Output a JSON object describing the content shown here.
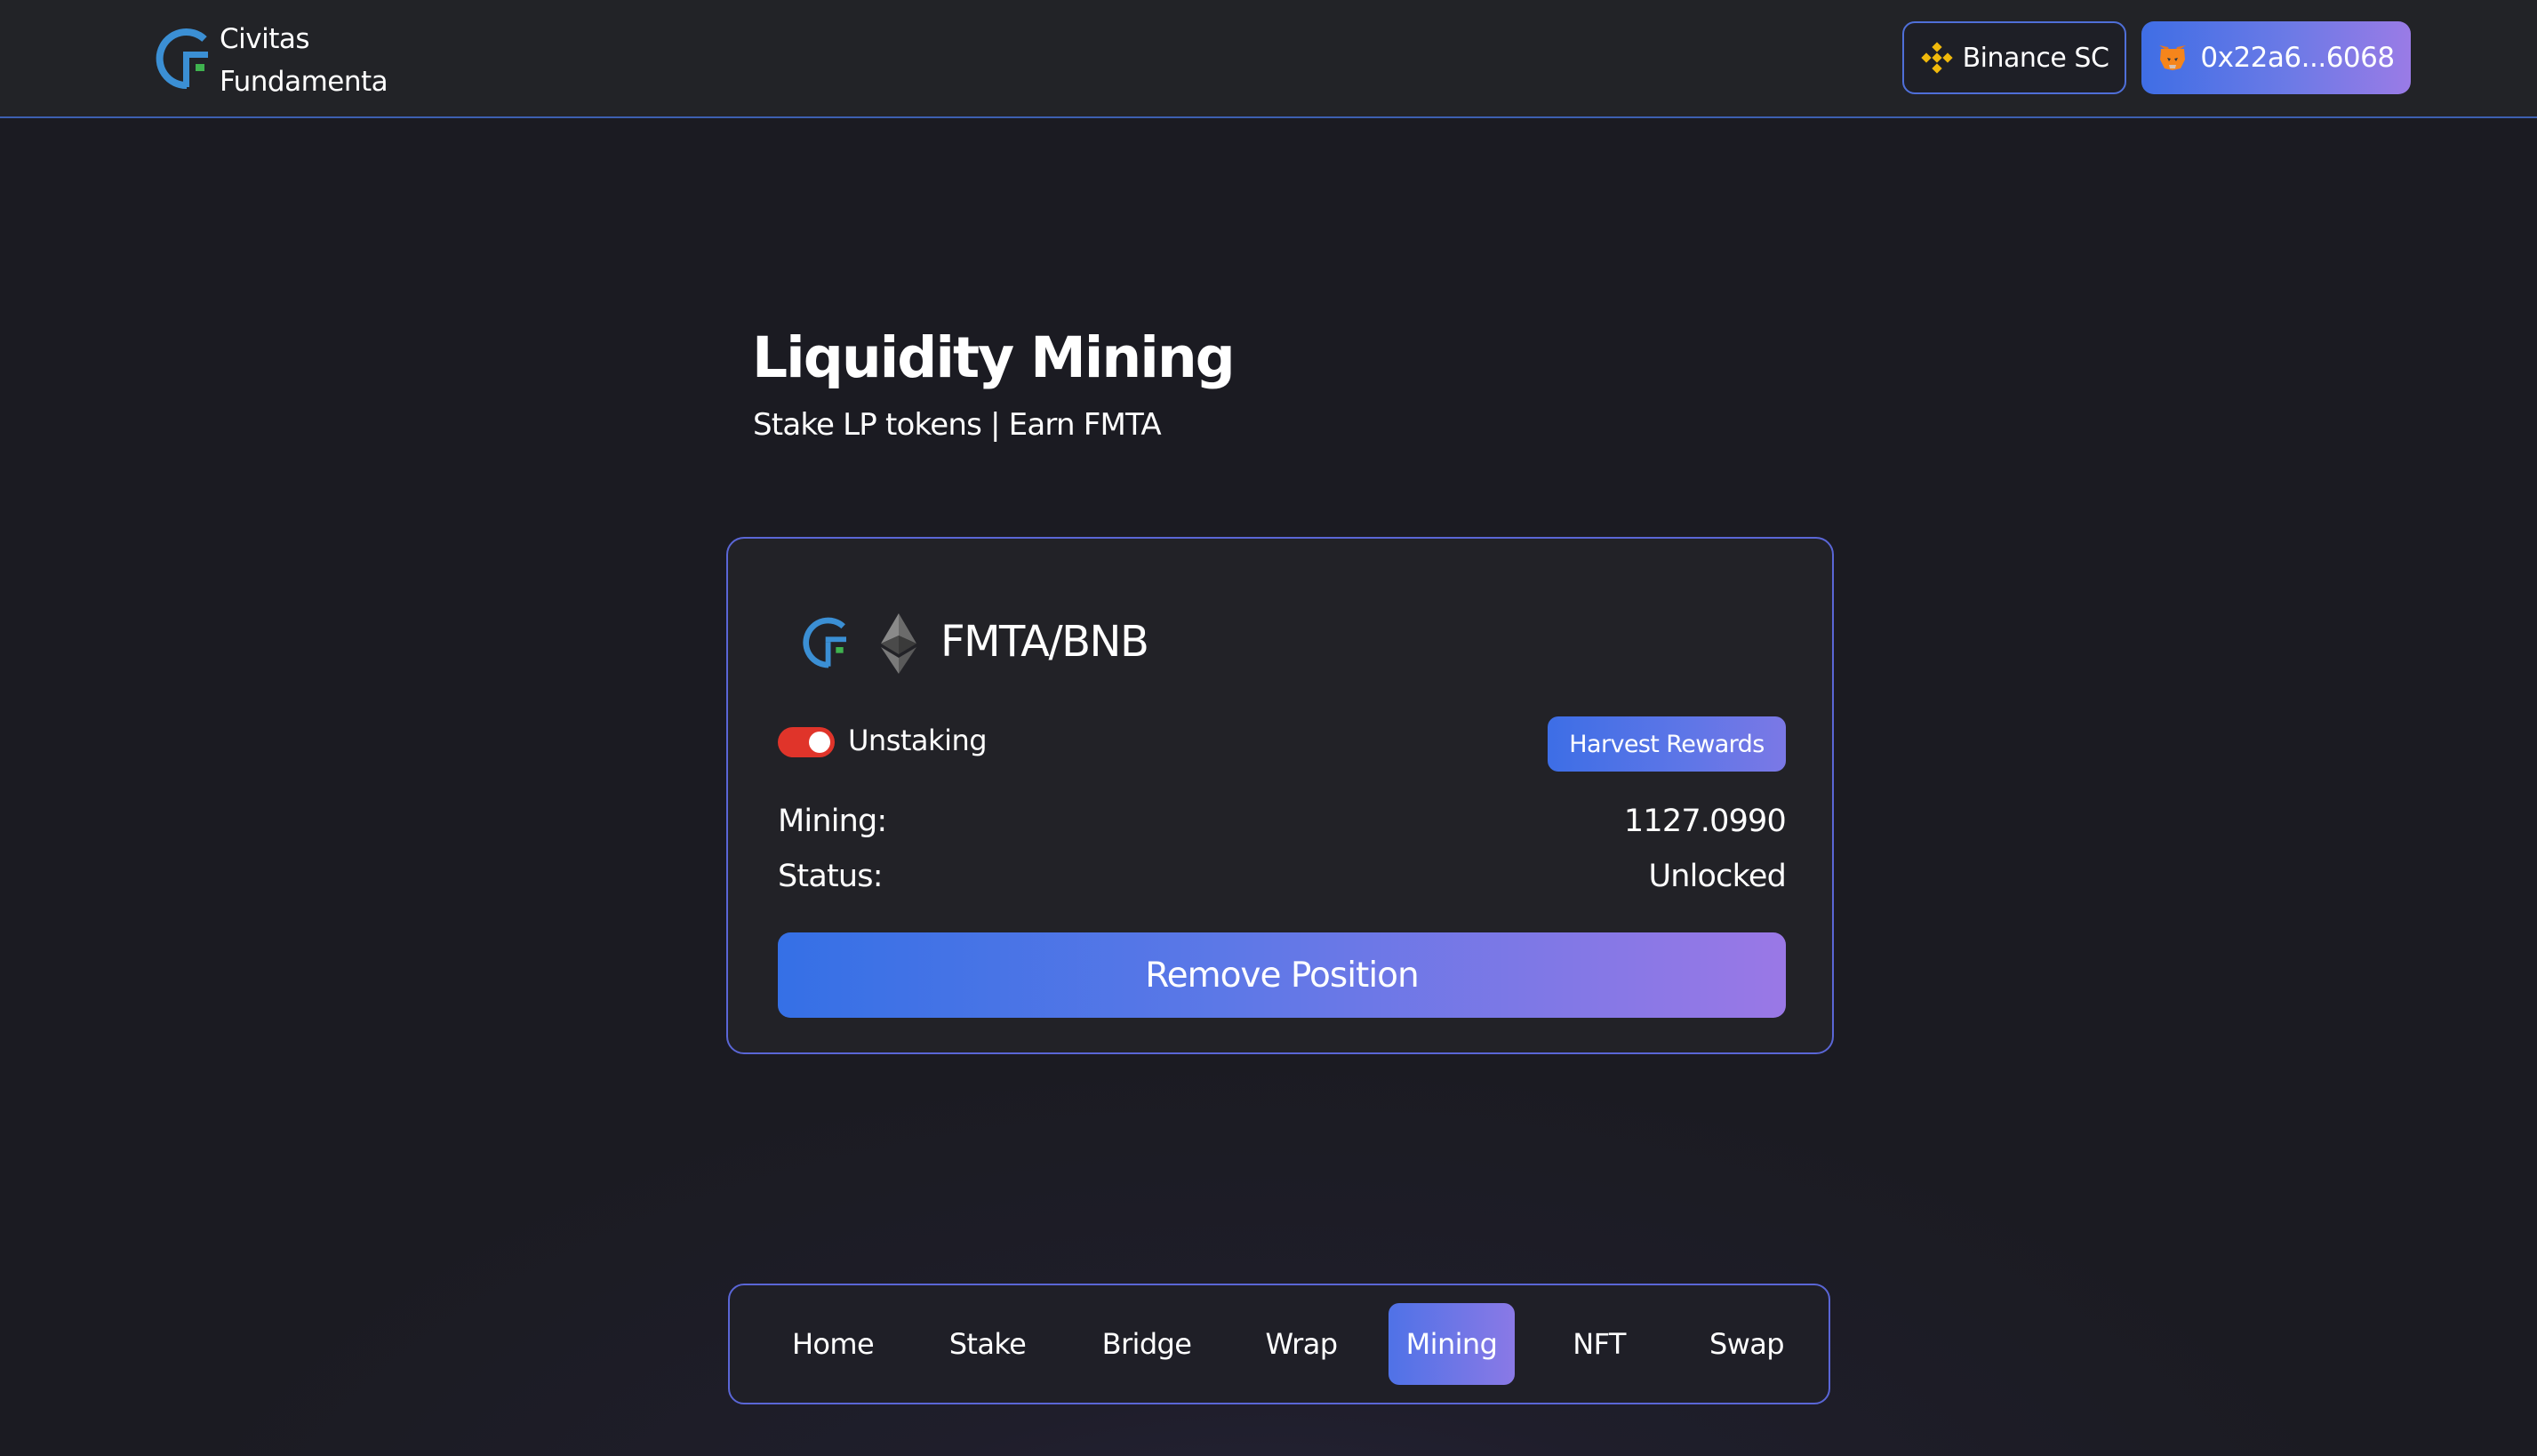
{
  "brand": {
    "line1": "Civitas",
    "line2": "Fundamenta"
  },
  "header": {
    "chain_label": "Binance SC",
    "chain_icon": "binance-icon",
    "wallet_label": "0x22a6...6068",
    "wallet_icon": "metamask-fox-icon"
  },
  "page": {
    "title": "Liquidity Mining",
    "subtitle": "Stake LP tokens | Earn FMTA"
  },
  "card": {
    "pair": "FMTA/BNB",
    "toggle_label": "Unstaking",
    "toggle_on": true,
    "harvest_label": "Harvest Rewards",
    "rows": [
      {
        "label": "Mining:",
        "value": "1127.0990"
      },
      {
        "label": "Status:",
        "value": "Unlocked"
      }
    ],
    "remove_label": "Remove Position"
  },
  "nav": {
    "items": [
      {
        "label": "Home"
      },
      {
        "label": "Stake"
      },
      {
        "label": "Bridge"
      },
      {
        "label": "Wrap"
      },
      {
        "label": "Mining",
        "active": true
      },
      {
        "label": "NFT"
      },
      {
        "label": "Swap"
      }
    ]
  },
  "colors": {
    "accent_blue": "#3d6ee6",
    "accent_purple": "#9a78e6",
    "toggle_red": "#e0342a",
    "logo_blue": "#3b8fd4",
    "logo_green": "#3fb34f"
  }
}
